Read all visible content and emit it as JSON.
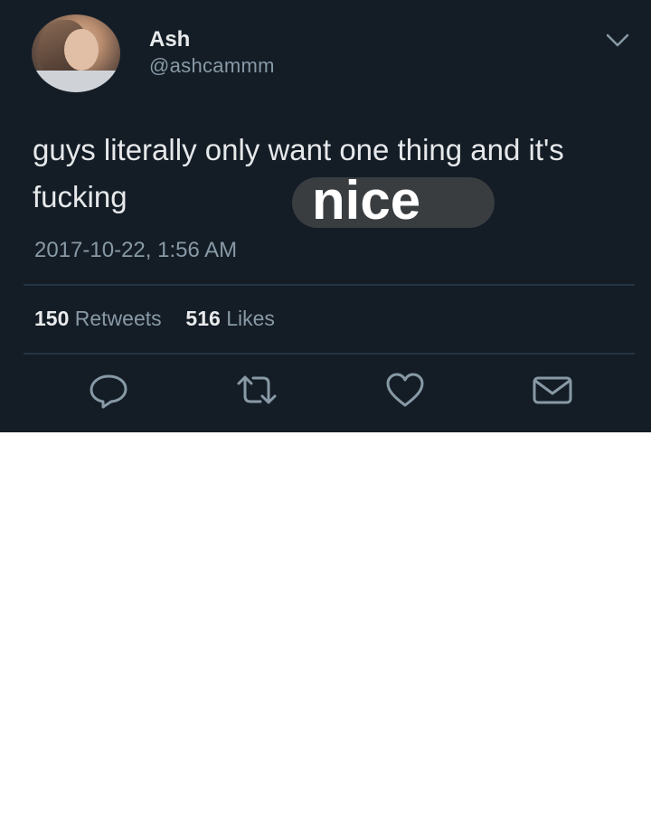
{
  "tweet": {
    "display_name": "Ash",
    "handle": "@ashcammm",
    "text": "guys literally only want one thing and it's fucking",
    "overlay_word": "nice",
    "timestamp": "2017-10-22, 1:56 AM",
    "retweets_count": "150",
    "retweets_label": "Retweets",
    "likes_count": "516",
    "likes_label": "Likes"
  },
  "icons": {
    "menu": "chevron-down-icon",
    "reply": "reply-icon",
    "retweet": "retweet-icon",
    "like": "heart-icon",
    "message": "envelope-icon"
  },
  "colors": {
    "background": "#141d26",
    "primary_text": "#e6e8ea",
    "secondary_text": "#8899a6",
    "badge": "#3a3d40",
    "page_background": "#ffffff"
  }
}
